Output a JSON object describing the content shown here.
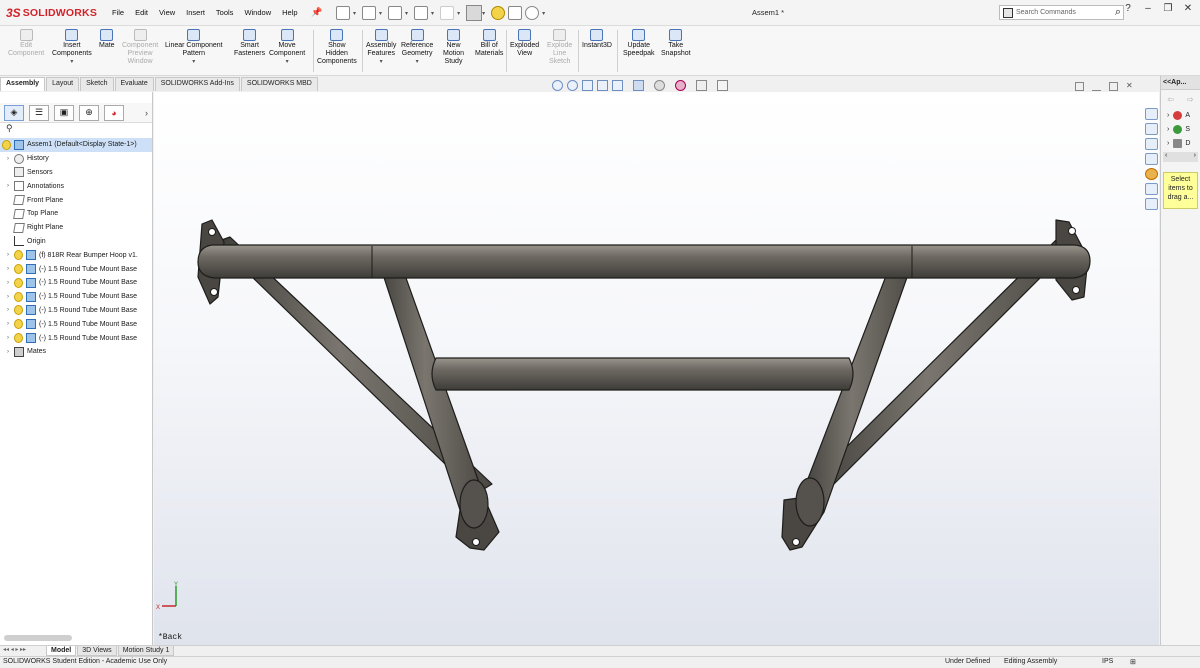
{
  "app": {
    "brand_ds": "3S",
    "brand_name": "SOLIDWORKS",
    "document_title": "Assem1 *",
    "menu": [
      "File",
      "Edit",
      "View",
      "Insert",
      "Tools",
      "Window",
      "Help"
    ],
    "search_placeholder": "Search Commands",
    "window_controls": [
      "?",
      "–",
      "❐",
      "✕"
    ]
  },
  "ribbon": {
    "buttons": [
      {
        "label": "Edit\nComponent",
        "icon": "edit-component-icon",
        "enabled": false
      },
      {
        "label": "Insert\nComponents",
        "icon": "insert-components-icon",
        "enabled": true,
        "dropdown": true
      },
      {
        "label": "Mate",
        "icon": "mate-icon",
        "enabled": true
      },
      {
        "label": "Component\nPreview\nWindow",
        "icon": "component-preview-icon",
        "enabled": false
      },
      {
        "label": "Linear Component\nPattern",
        "icon": "linear-pattern-icon",
        "enabled": true,
        "dropdown": true
      },
      {
        "label": "Smart\nFasteners",
        "icon": "smart-fasteners-icon",
        "enabled": true
      },
      {
        "label": "Move\nComponent",
        "icon": "move-component-icon",
        "enabled": true,
        "dropdown": true
      },
      {
        "label": "Show\nHidden\nComponents",
        "icon": "show-hidden-icon",
        "enabled": true
      },
      {
        "label": "Assembly\nFeatures",
        "icon": "assembly-features-icon",
        "enabled": true,
        "dropdown": true
      },
      {
        "label": "Reference\nGeometry",
        "icon": "reference-geometry-icon",
        "enabled": true,
        "dropdown": true
      },
      {
        "label": "New\nMotion\nStudy",
        "icon": "new-motion-study-icon",
        "enabled": true
      },
      {
        "label": "Bill of\nMaterials",
        "icon": "bill-of-materials-icon",
        "enabled": true
      },
      {
        "label": "Exploded\nView",
        "icon": "exploded-view-icon",
        "enabled": true
      },
      {
        "label": "Explode\nLine\nSketch",
        "icon": "explode-line-sketch-icon",
        "enabled": false
      },
      {
        "label": "Instant3D",
        "icon": "instant3d-icon",
        "enabled": true
      },
      {
        "label": "Update\nSpeedpak",
        "icon": "update-speedpak-icon",
        "enabled": true
      },
      {
        "label": "Take\nSnapshot",
        "icon": "take-snapshot-icon",
        "enabled": true
      }
    ]
  },
  "command_tabs": [
    "Assembly",
    "Layout",
    "Sketch",
    "Evaluate",
    "SOLIDWORKS Add-Ins",
    "SOLIDWORKS MBD"
  ],
  "active_command_tab": "Assembly",
  "feature_tree": {
    "root": "Assem1  (Default<Display State-1>)",
    "items": [
      {
        "label": "History",
        "icon": "history-icon",
        "expandable": true
      },
      {
        "label": "Sensors",
        "icon": "sensors-icon",
        "expandable": false
      },
      {
        "label": "Annotations",
        "icon": "annotations-icon",
        "expandable": true
      },
      {
        "label": "Front Plane",
        "icon": "plane-icon",
        "expandable": false
      },
      {
        "label": "Top Plane",
        "icon": "plane-icon",
        "expandable": false
      },
      {
        "label": "Right Plane",
        "icon": "plane-icon",
        "expandable": false
      },
      {
        "label": "Origin",
        "icon": "origin-icon",
        "expandable": false
      },
      {
        "label": "(f) 818R Rear Bumper Hoop v1.",
        "icon": "part-icon",
        "expandable": true,
        "warning": true
      },
      {
        "label": "(-) 1.5 Round Tube Mount Base",
        "icon": "part-icon",
        "expandable": true,
        "warning": true
      },
      {
        "label": "(-) 1.5 Round Tube Mount Base",
        "icon": "part-icon",
        "expandable": true,
        "warning": true
      },
      {
        "label": "(-) 1.5 Round Tube Mount Base",
        "icon": "part-icon",
        "expandable": true,
        "warning": true
      },
      {
        "label": "(-) 1.5 Round Tube Mount Base",
        "icon": "part-icon",
        "expandable": true,
        "warning": true
      },
      {
        "label": "(-) 1.5 Round Tube Mount Base",
        "icon": "part-icon",
        "expandable": true,
        "warning": true
      },
      {
        "label": "(-) 1.5 Round Tube Mount Base",
        "icon": "part-icon",
        "expandable": true,
        "warning": true
      },
      {
        "label": "Mates",
        "icon": "mates-icon",
        "expandable": true
      }
    ]
  },
  "viewport": {
    "view_label": "*Back",
    "triad": {
      "x": "X",
      "y": "Y"
    }
  },
  "task_pane": {
    "header": "<<Ap...",
    "items": [
      "A",
      "S",
      "D"
    ],
    "note": "Select\nitems to\ndrag a..."
  },
  "bottom_tabs": [
    "Model",
    "3D Views",
    "Motion Study 1"
  ],
  "active_bottom_tab": "Model",
  "status": {
    "left": "SOLIDWORKS Student Edition - Academic Use Only",
    "definition": "Under Defined",
    "mode": "Editing Assembly",
    "units": "IPS"
  },
  "colors": {
    "brand": "#d2232a",
    "tube_fill": "#5e5b55",
    "tube_highlight": "#8d8a83",
    "selection": "#cde0f7",
    "accent": "#2a6fc9"
  }
}
